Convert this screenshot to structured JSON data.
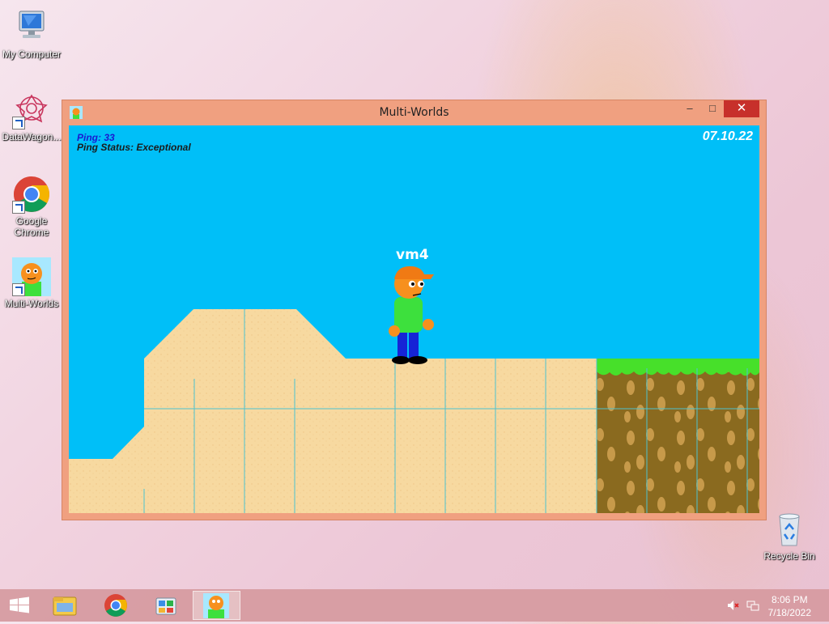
{
  "desktop": {
    "icons": [
      {
        "label": "My Computer",
        "icon": "computer-icon"
      },
      {
        "label": "DataWagon...",
        "icon": "datawagon-icon"
      },
      {
        "label": "Google Chrome",
        "icon": "chrome-icon"
      },
      {
        "label": "Multi-Worlds",
        "icon": "multiworlds-icon"
      },
      {
        "label": "Recycle Bin",
        "icon": "recycle-bin-icon"
      }
    ]
  },
  "window": {
    "title": "Multi-Worlds",
    "controls": {
      "minimize": "–",
      "maximize": "□",
      "close": "✕"
    }
  },
  "game": {
    "ping_label": "Ping: 33",
    "ping_status": "Ping Status: Exceptional",
    "date": "07.10.22",
    "player_name": "vm4",
    "colors": {
      "sky": "#00bff8",
      "sand": "#f7d9a0",
      "grass": "#47e02a",
      "dirt": "#8a6a1f",
      "ping": "#1a1ad0"
    }
  },
  "taskbar": {
    "items": [
      "start-icon",
      "file-explorer-icon",
      "chrome-icon",
      "control-panel-icon",
      "multiworlds-icon"
    ],
    "time": "8:06 PM",
    "date": "7/18/2022"
  }
}
